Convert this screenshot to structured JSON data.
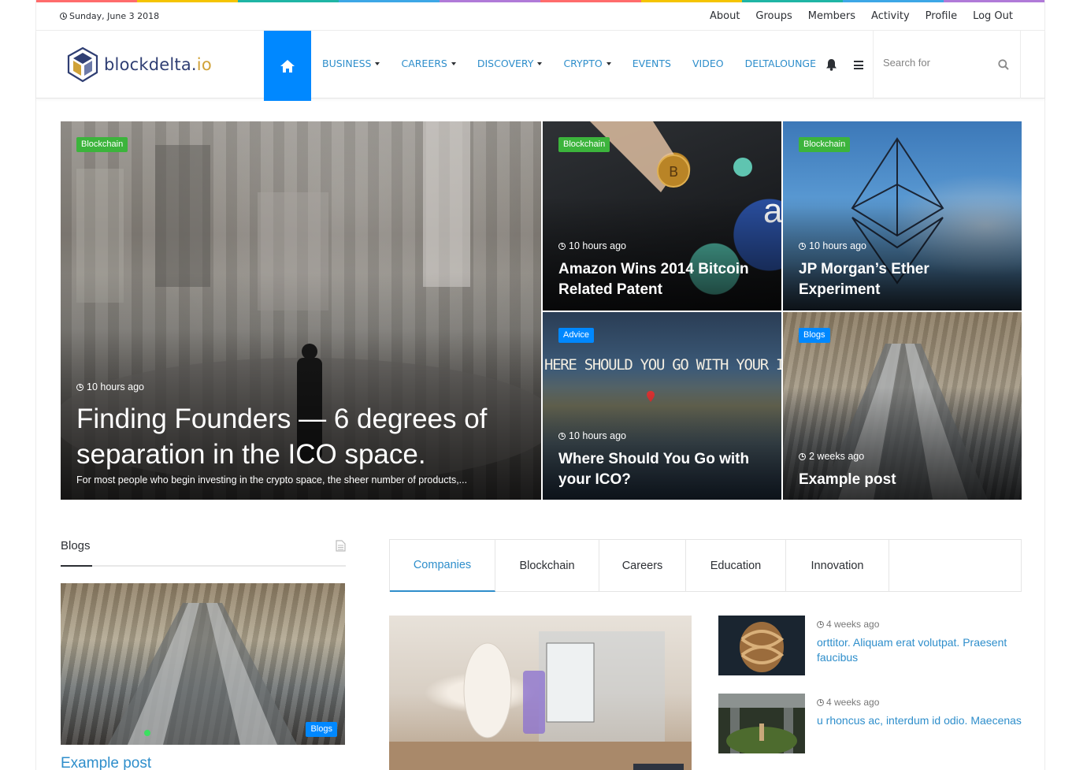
{
  "brand_colors": [
    "#ff6c6c",
    "#f5c400",
    "#1fb5a5",
    "#3da7e6",
    "#b07ad8",
    "#ff6c6c",
    "#f5c400",
    "#1fb5a5",
    "#3da7e6",
    "#b07ad8"
  ],
  "topbar": {
    "date": "Sunday, June 3 2018",
    "links": [
      "About",
      "Groups",
      "Members",
      "Activity",
      "Profile",
      "Log Out"
    ]
  },
  "header": {
    "logo_main": "blockdelta.",
    "logo_accent": "io",
    "nav": [
      {
        "label": "BUSINESS",
        "dropdown": true
      },
      {
        "label": "CAREERS",
        "dropdown": true
      },
      {
        "label": "DISCOVERY",
        "dropdown": true
      },
      {
        "label": "CRYPTO",
        "dropdown": true
      },
      {
        "label": "EVENTS",
        "dropdown": false
      },
      {
        "label": "VIDEO",
        "dropdown": false
      },
      {
        "label": "DELTALOUNGE",
        "dropdown": false
      }
    ],
    "search_placeholder": "Search for",
    "accent_color": "#0088ff"
  },
  "hero": {
    "main": {
      "category": "Blockchain",
      "time": "10 hours ago",
      "title": "Finding Founders — 6 degrees of separation in the ICO space.",
      "excerpt": "For most people who begin investing in the crypto space, the sheer number of products,..."
    },
    "tiles": [
      {
        "category": "Blockchain",
        "time": "10 hours ago",
        "title": "Amazon Wins 2014 Bitcoin Related Patent"
      },
      {
        "category": "Blockchain",
        "time": "10 hours ago",
        "title": "JP Morgan’s Ether Experiment"
      },
      {
        "category": "Advice",
        "time": "10 hours ago",
        "title": "Where Should You Go with your ICO?",
        "image_text": "HERE SHOULD YOU GO WITH YOUR I"
      },
      {
        "category": "Blogs",
        "time": "2 weeks ago",
        "title": "Example post"
      }
    ]
  },
  "blogs": {
    "heading": "Blogs",
    "badge": "Blogs",
    "post_title": "Example post"
  },
  "tabs": {
    "items": [
      "Companies",
      "Blockchain",
      "Careers",
      "Education",
      "Innovation"
    ],
    "active": "Companies"
  },
  "side_posts": [
    {
      "time": "4 weeks ago",
      "title": "orttitor. Aliquam erat volutpat. Praesent faucibus"
    },
    {
      "time": "4 weeks ago",
      "title": "u rhoncus ac, interdum id odio. Maecenas"
    }
  ]
}
